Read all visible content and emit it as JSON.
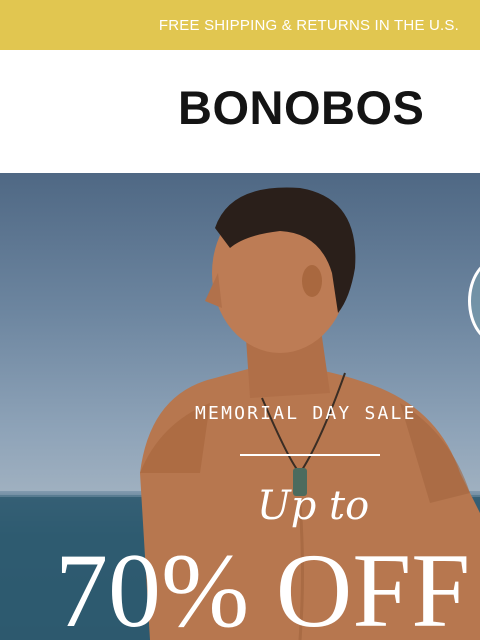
{
  "promo": {
    "text": "FREE SHIPPING & RETURNS IN THE U.S."
  },
  "header": {
    "logo": "BONOBOS"
  },
  "hero": {
    "kicker": "MEMORIAL DAY SALE",
    "upto": "Up to",
    "headline": "70% OFF"
  },
  "icons": {
    "side_badge": "carousel-badge-icon"
  },
  "colors": {
    "promo_bar": "#e1c650",
    "logo": "#141414",
    "hero_text": "#ffffff"
  }
}
